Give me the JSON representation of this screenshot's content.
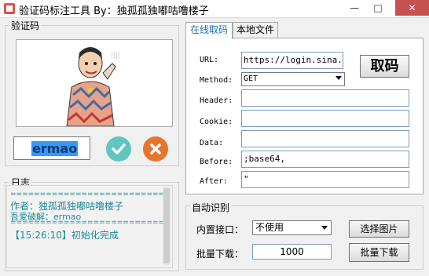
{
  "window": {
    "title": "验证码标注工具 By：独孤孤独嘟咕噜楼子"
  },
  "captcha_group": {
    "label": "验证码",
    "answer": "ermao"
  },
  "log": {
    "label": "日志",
    "separator": "==========================",
    "lines": [
      "作者：独孤孤独嘟咕噜楼子",
      "吾爱破解：ermao",
      "【15:26:10】初始化完成"
    ]
  },
  "tabs": [
    "在线取码",
    "本地文件"
  ],
  "online": {
    "url_label": "URL:",
    "url_value": "https://login.sina.com",
    "method_label": "Method:",
    "method_value": "GET",
    "header_label": "Header:",
    "header_value": "",
    "cookie_label": "Cookie:",
    "cookie_value": "",
    "data_label": "Data:",
    "data_value": "",
    "before_label": "Before:",
    "before_value": ";base64,",
    "after_label": "After:",
    "after_value": "\"",
    "fetch_label": "取码"
  },
  "auto": {
    "label": "自动识别",
    "interface_label": "内置接口：",
    "interface_value": "不使用",
    "choose_image_label": "选择图片",
    "batch_label": "批量下载：",
    "batch_value": "1000",
    "batch_button_label": "批量下载"
  },
  "colors": {
    "accent": "#1b6fb3",
    "ok": "#5fc6c0",
    "cancel": "#e8752d",
    "log_text": "#1b8a9a"
  }
}
